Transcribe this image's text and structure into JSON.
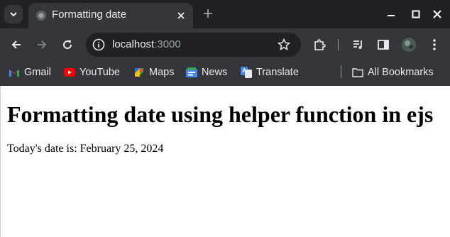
{
  "tab": {
    "title": "Formatting date"
  },
  "address_bar": {
    "host": "localhost",
    "port": ":3000"
  },
  "bookmarks": [
    {
      "label": "Gmail",
      "icon": "gmail-icon"
    },
    {
      "label": "YouTube",
      "icon": "youtube-icon"
    },
    {
      "label": "Maps",
      "icon": "maps-icon"
    },
    {
      "label": "News",
      "icon": "news-icon"
    },
    {
      "label": "Translate",
      "icon": "translate-icon"
    }
  ],
  "all_bookmarks": {
    "label": "All Bookmarks",
    "icon": "folder-icon"
  },
  "page": {
    "heading": "Formatting date using helper function in ejs",
    "date_label": "Today's date is:",
    "date_value": "February 25, 2024"
  },
  "colors": {
    "tabstrip_bg": "#202124",
    "toolbar_bg": "#35363a",
    "text_light": "#e8eaed",
    "text_muted": "#9aa0a6",
    "page_bg": "#ffffff"
  }
}
